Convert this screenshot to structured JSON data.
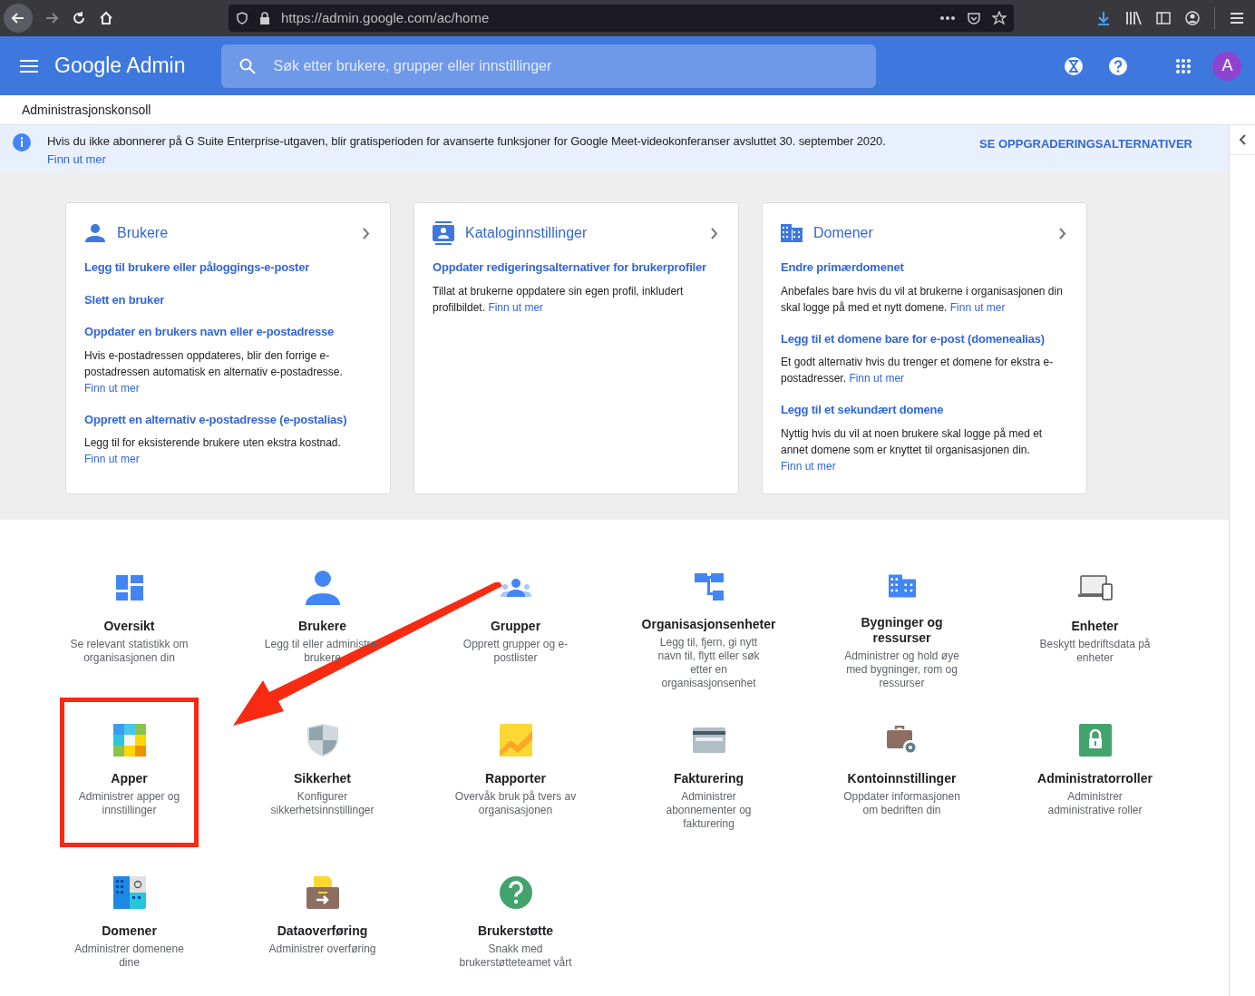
{
  "browser": {
    "url": "https://admin.google.com/ac/home"
  },
  "header": {
    "title": "Google Admin",
    "search_placeholder": "Søk etter brukere, grupper eller innstillinger",
    "avatar": "A"
  },
  "console_title": "Administrasjonskonsoll",
  "banner": {
    "text": "Hvis du ikke abonnerer på G Suite Enterprise-utgaven, blir gratisperioden for avanserte funksjoner for Google Meet-videokonferanser avsluttet 30. september 2020.",
    "link": "Finn ut mer",
    "action": "SE OPPGRADERINGSALTERNATIVER"
  },
  "cards": [
    {
      "title": "Brukere",
      "sections": [
        {
          "link": "Legg til brukere eller påloggings-e-poster"
        },
        {
          "link": "Slett en bruker"
        },
        {
          "link": "Oppdater en brukers navn eller e-postadresse",
          "text": "Hvis e-postadressen oppdateres, blir den forrige e-postadressen automatisk en alternativ e-postadresse.",
          "more": "Finn ut mer"
        },
        {
          "link": "Opprett en alternativ e-postadresse (e-postalias)",
          "text": "Legg til for eksisterende brukere uten ekstra kostnad.",
          "more": "Finn ut mer"
        }
      ]
    },
    {
      "title": "Kataloginnstillinger",
      "sections": [
        {
          "link": "Oppdater redigeringsalternativer for brukerprofiler",
          "text": "Tillat at brukerne oppdatere sin egen profil, inkludert profilbildet.",
          "more": "Finn ut mer"
        }
      ]
    },
    {
      "title": "Domener",
      "sections": [
        {
          "link": "Endre primærdomenet",
          "text": "Anbefales bare hvis du vil at brukerne i organisasjonen din skal logge på med et nytt domene.",
          "more": "Finn ut mer"
        },
        {
          "link": "Legg til et domene bare for e-post (domenealias)",
          "text": "Et godt alternativ hvis du trenger et domene for ekstra e-postadresser.",
          "more": "Finn ut mer"
        },
        {
          "link": "Legg til et sekundært domene",
          "text": "Nyttig hvis du vil at noen brukere skal logge på med et annet domene som er knyttet til organisasjonen din.",
          "more": "Finn ut mer"
        }
      ]
    }
  ],
  "tiles": [
    {
      "title": "Oversikt",
      "desc": "Se relevant statistikk om organisasjonen din",
      "highlighted": false
    },
    {
      "title": "Brukere",
      "desc": "Legg til eller administrer brukere",
      "highlighted": false
    },
    {
      "title": "Grupper",
      "desc": "Opprett grupper og e-postlister",
      "highlighted": false
    },
    {
      "title": "Organisasjonsenheter",
      "desc": "Legg til, fjern, gi nytt navn til, flytt eller søk etter en organisasjonsenhet",
      "highlighted": false
    },
    {
      "title": "Bygninger og ressurser",
      "desc": "Administrer og hold øye med bygninger, rom og ressurser",
      "highlighted": false
    },
    {
      "title": "Enheter",
      "desc": "Beskytt bedriftsdata på enheter",
      "highlighted": false
    },
    {
      "title": "Apper",
      "desc": "Administrer apper og innstillinger",
      "highlighted": true
    },
    {
      "title": "Sikkerhet",
      "desc": "Konfigurer sikkerhetsinnstillinger",
      "highlighted": false
    },
    {
      "title": "Rapporter",
      "desc": "Overvåk bruk på tvers av organisasjonen",
      "highlighted": false
    },
    {
      "title": "Fakturering",
      "desc": "Administrer abonnementer og fakturering",
      "highlighted": false
    },
    {
      "title": "Kontoinnstillinger",
      "desc": "Oppdater informasjonen om bedriften din",
      "highlighted": false
    },
    {
      "title": "Administratorroller",
      "desc": "Administrer administrative roller",
      "highlighted": false
    },
    {
      "title": "Domener",
      "desc": "Administrer domenene dine",
      "highlighted": false
    },
    {
      "title": "Dataoverføring",
      "desc": "Administrer overføring",
      "highlighted": false
    },
    {
      "title": "Brukerstøtte",
      "desc": "Snakk med brukerstøtteteamet vårt",
      "highlighted": false
    }
  ]
}
